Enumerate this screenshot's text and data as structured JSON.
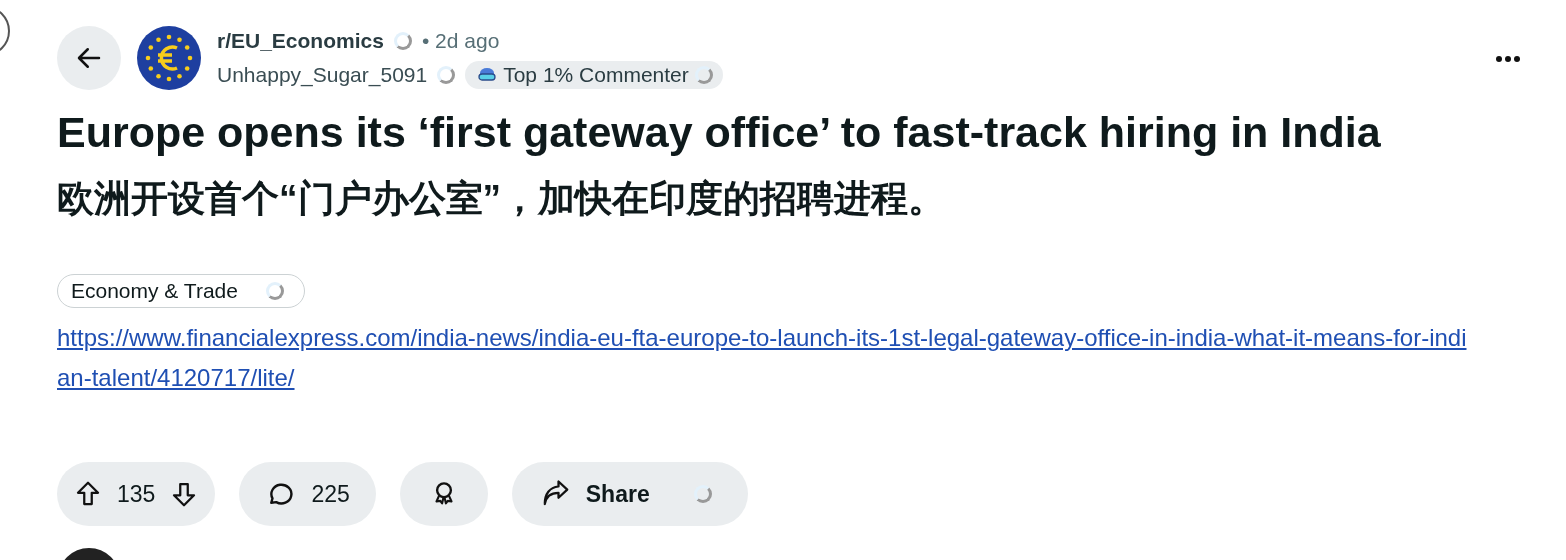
{
  "post": {
    "subreddit": "r/EU_Economics",
    "time": "• 2d ago",
    "author": "Unhappy_Sugar_5091",
    "author_badge": "Top 1% Commenter",
    "title": "Europe opens its ‘first gateway office’ to fast-track hiring in India",
    "title_translation": "欧洲开设首个“门户办公室”，加快在印度的招聘进程。",
    "flair": "Economy & Trade",
    "link": "https://www.financialexpress.com/india-news/india-eu-fta-europe-to-launch-its-1st-legal-gateway-office-in-india-what-it-means-for-indian-talent/4120717/lite/"
  },
  "actions": {
    "votes": "135",
    "comments": "225",
    "share": "Share"
  }
}
